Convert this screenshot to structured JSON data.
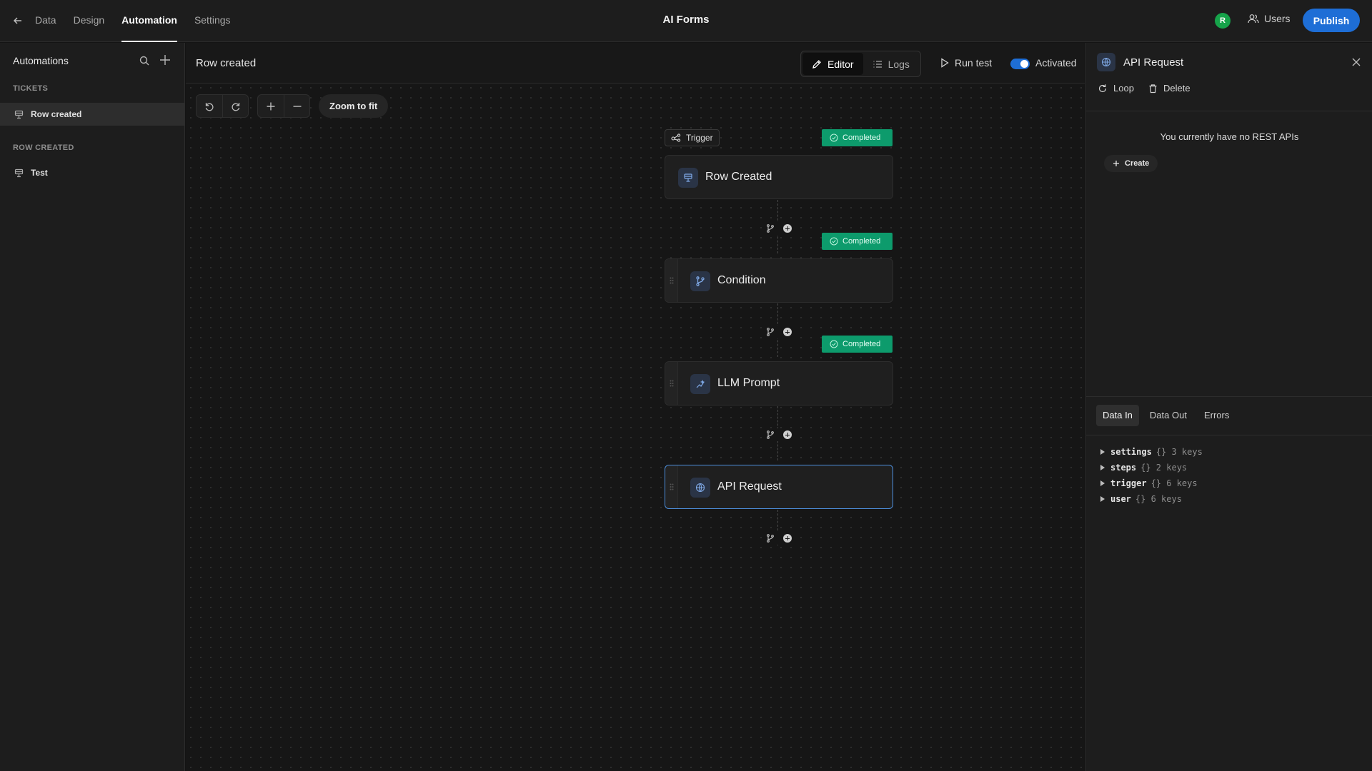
{
  "topbar": {
    "nav": [
      "Data",
      "Design",
      "Automation",
      "Settings"
    ],
    "active_nav": "Automation",
    "app_title": "AI Forms",
    "avatar_initial": "R",
    "users_label": "Users",
    "publish_label": "Publish"
  },
  "sidebar": {
    "title": "Automations",
    "sections": [
      {
        "heading": "TICKETS",
        "items": [
          {
            "label": "Row created",
            "selected": true
          }
        ]
      },
      {
        "heading": "ROW CREATED",
        "items": [
          {
            "label": "Test",
            "selected": false
          }
        ]
      }
    ]
  },
  "main": {
    "title": "Row created",
    "tabs": [
      "Editor",
      "Logs"
    ],
    "active_tab": "Editor",
    "run_test_label": "Run test",
    "activated_label": "Activated",
    "activated": true,
    "zoom_fit_label": "Zoom to fit"
  },
  "flow": {
    "trigger_tag": "Trigger",
    "steps": [
      {
        "label": "Row Created",
        "status": "Completed",
        "icon": "table-row-icon"
      },
      {
        "label": "Condition",
        "status": "Completed",
        "icon": "branch-icon"
      },
      {
        "label": "LLM Prompt",
        "status": "Completed",
        "icon": "sparkle-line-icon"
      },
      {
        "label": "API Request",
        "status": "",
        "icon": "globe-icon",
        "selected": true
      }
    ]
  },
  "panel": {
    "title": "API Request",
    "loop_label": "Loop",
    "delete_label": "Delete",
    "empty_message": "You currently have no REST APIs",
    "create_label": "Create",
    "tabs": [
      "Data In",
      "Data Out",
      "Errors"
    ],
    "active_tab": "Data In",
    "tree": [
      {
        "key": "settings",
        "meta": "{} 3 keys"
      },
      {
        "key": "steps",
        "meta": "{} 2 keys"
      },
      {
        "key": "trigger",
        "meta": "{} 6 keys"
      },
      {
        "key": "user",
        "meta": "{} 6 keys"
      }
    ]
  },
  "colors": {
    "accent": "#1e6ed6",
    "status_completed": "#0d9b6c",
    "avatar": "#16a34a"
  }
}
